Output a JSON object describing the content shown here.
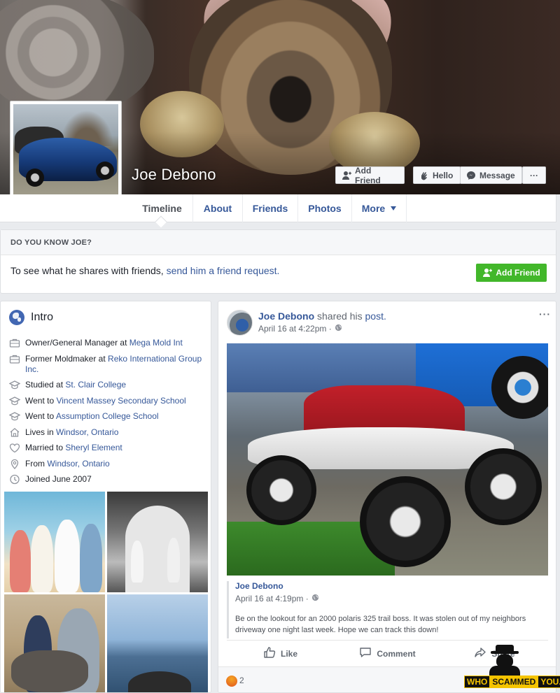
{
  "profile": {
    "name": "Joe Debono"
  },
  "cover_actions": {
    "add_friend": "Add Friend",
    "hello": "Hello",
    "message": "Message",
    "more": "···"
  },
  "nav": {
    "tabs": [
      "Timeline",
      "About",
      "Friends",
      "Photos",
      "More"
    ],
    "active": "Timeline"
  },
  "know": {
    "header": "DO YOU KNOW JOE?",
    "prefix": "To see what he shares with friends,",
    "link": "send him a friend request.",
    "button": "Add Friend"
  },
  "intro": {
    "title": "Intro",
    "items": [
      {
        "icon": "briefcase-icon",
        "pre": "Owner/General Manager at ",
        "link": "Mega Mold Int"
      },
      {
        "icon": "briefcase-icon",
        "pre": "Former Moldmaker at ",
        "link": "Reko International Group Inc."
      },
      {
        "icon": "graduation-cap-icon",
        "pre": "Studied at ",
        "link": "St. Clair College"
      },
      {
        "icon": "graduation-cap-icon",
        "pre": "Went to ",
        "link": "Vincent Massey Secondary School"
      },
      {
        "icon": "graduation-cap-icon",
        "pre": "Went to ",
        "link": "Assumption College School"
      },
      {
        "icon": "house-icon",
        "pre": "Lives in ",
        "link": "Windsor, Ontario"
      },
      {
        "icon": "heart-icon",
        "pre": "Married to ",
        "link": "Sheryl Element"
      },
      {
        "icon": "location-pin-icon",
        "pre": "From ",
        "link": "Windsor, Ontario"
      },
      {
        "icon": "clock-icon",
        "pre": "Joined June 2007",
        "link": ""
      }
    ]
  },
  "post": {
    "author": "Joe Debono",
    "action_pre": "shared his ",
    "action_link": "post.",
    "time": "April 16 at 4:22pm ·",
    "more": "···",
    "shared": {
      "author": "Joe Debono",
      "time": "April 16 at 4:19pm ·",
      "text": "Be on the lookout for an 2000 polaris 325 trail boss. It was stolen out of my neighbors driveway one night last week. Hope we can track this down!"
    },
    "actions": {
      "like": "Like",
      "comment": "Comment",
      "share": "Share"
    },
    "reaction_count": "2"
  },
  "watermark": {
    "who": "WHO",
    "scammed": "SCAMMED",
    "you": "YOU.COM"
  }
}
